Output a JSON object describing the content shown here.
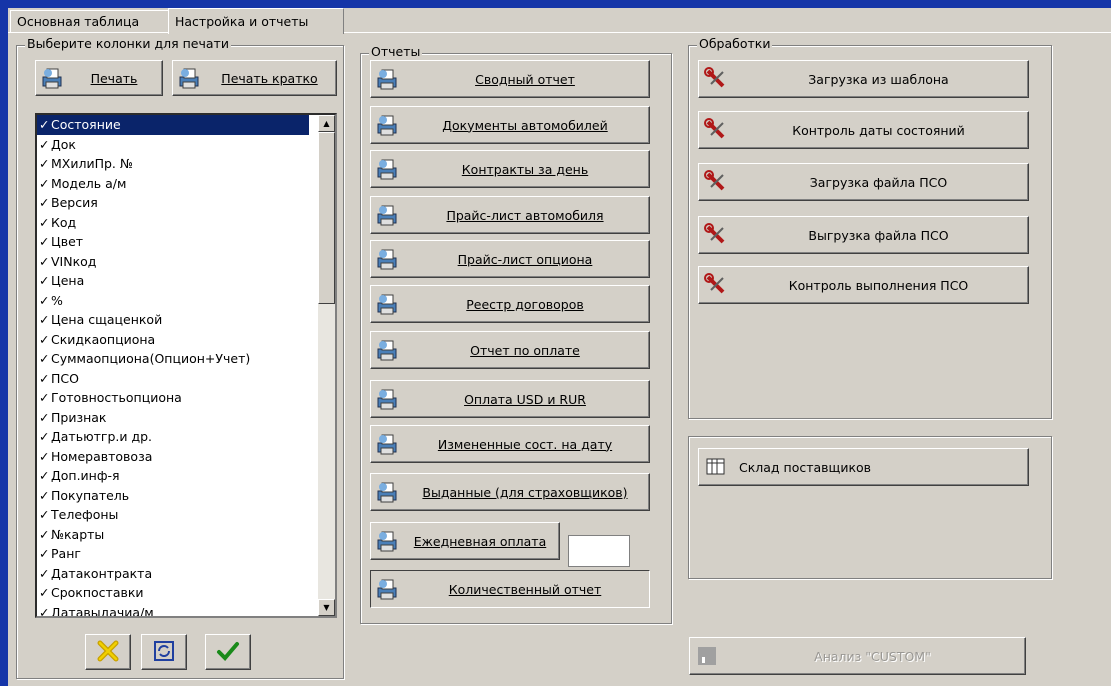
{
  "tabs": [
    {
      "label": "Основная таблица"
    },
    {
      "label": "Настройка и отчеты"
    }
  ],
  "columns_group": {
    "legend": "Выберите колонки для печати",
    "print_label": "Печать",
    "print_short_label": "Печать кратко",
    "items": [
      "Состояние",
      "Док",
      "МХилиПр. №",
      "Модель а/м",
      "Версия",
      "Код",
      "Цвет",
      "VINкод",
      "Цена",
      "%",
      "Цена сщаценкой",
      "Скидкаопциона",
      "Суммаопциона(Опцион+Учет)",
      "ПСО",
      "Готовностьопциона",
      "Признак",
      "Датьютгр.и др.",
      "Номеравтовоза",
      "Доп.инф-я",
      "Покупатель",
      "Телефоны",
      "№карты",
      "Ранг",
      "Датаконтракта",
      "Срокпоставки",
      "Датавыдачиа/м"
    ]
  },
  "reports_group": {
    "legend": "Отчеты",
    "buttons": [
      "Сводный отчет",
      "Документы автомобилей",
      "Контракты за день",
      "Прайс-лист автомобиля",
      "Прайс-лист опциона",
      "Реестр договоров",
      "Отчет по оплате",
      "Оплата USD и RUR",
      "Измененные сост. на дату",
      "Выданные (для страховщиков)",
      "Ежедневная оплата",
      "Количественный отчет"
    ]
  },
  "processing_group": {
    "legend": "Обработки",
    "buttons": [
      "Загрузка из шаблона",
      "Контроль даты состояний",
      "Загрузка файла ПСО",
      "Выгрузка файла ПСО",
      "Контроль выполнения ПСО"
    ]
  },
  "warehouse_button": "Склад поставщиков",
  "analysis_button": "Анализ \"CUSTOM\"",
  "colors": {
    "desktop": "#1535a8",
    "face": "#d4d0c8",
    "selection": "#0a246a"
  }
}
